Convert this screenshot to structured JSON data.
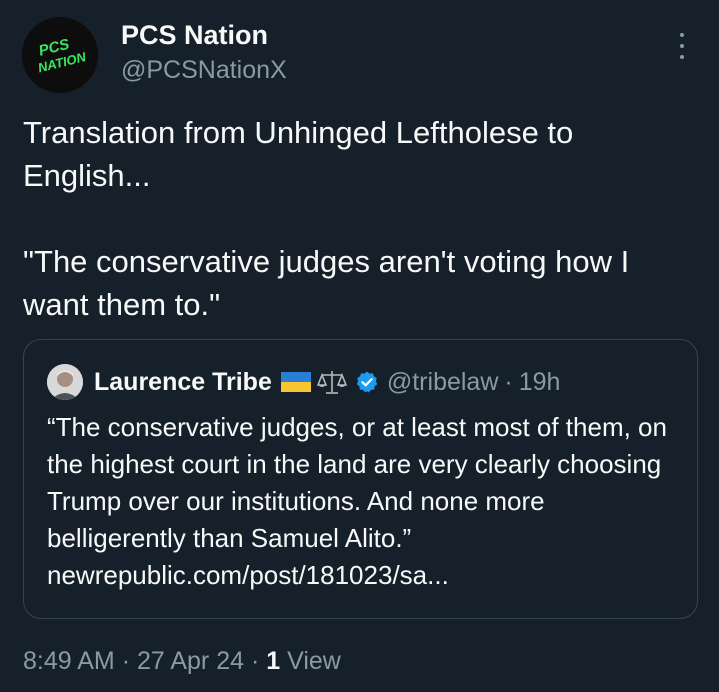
{
  "author": {
    "display_name": "PCS Nation",
    "handle": "@PCSNationX",
    "avatar_text_line1": "PCS",
    "avatar_text_line2": "NATION"
  },
  "tweet": {
    "text": "Translation from Unhinged Leftholese to English...\n\n\"The conservative judges aren't voting how I want them to.\""
  },
  "quote": {
    "display_name": "Laurence Tribe",
    "handle": "@tribelaw",
    "separator": "·",
    "time": "19h",
    "text": "“The conservative judges, or at least most of them, on the highest court in the land are very clearly choosing Trump over our institutions. And none more belligerently than Samuel Alito.”\nnewrepublic.com/post/181023/sa..."
  },
  "footer": {
    "time": "8:49 AM",
    "separator1": "·",
    "date": "27 Apr 24",
    "separator2": "·",
    "views_count": "1",
    "views_label": "View"
  },
  "colors": {
    "background": "#15202b",
    "text_primary": "#f7f9f9",
    "text_secondary": "#8b98a5",
    "border": "#38444d",
    "verified": "#1d9bf0",
    "avatar_text": "#39e75f"
  },
  "icons": [
    "more-icon",
    "ukraine-flag-icon",
    "scales-icon",
    "verified-badge-icon"
  ]
}
